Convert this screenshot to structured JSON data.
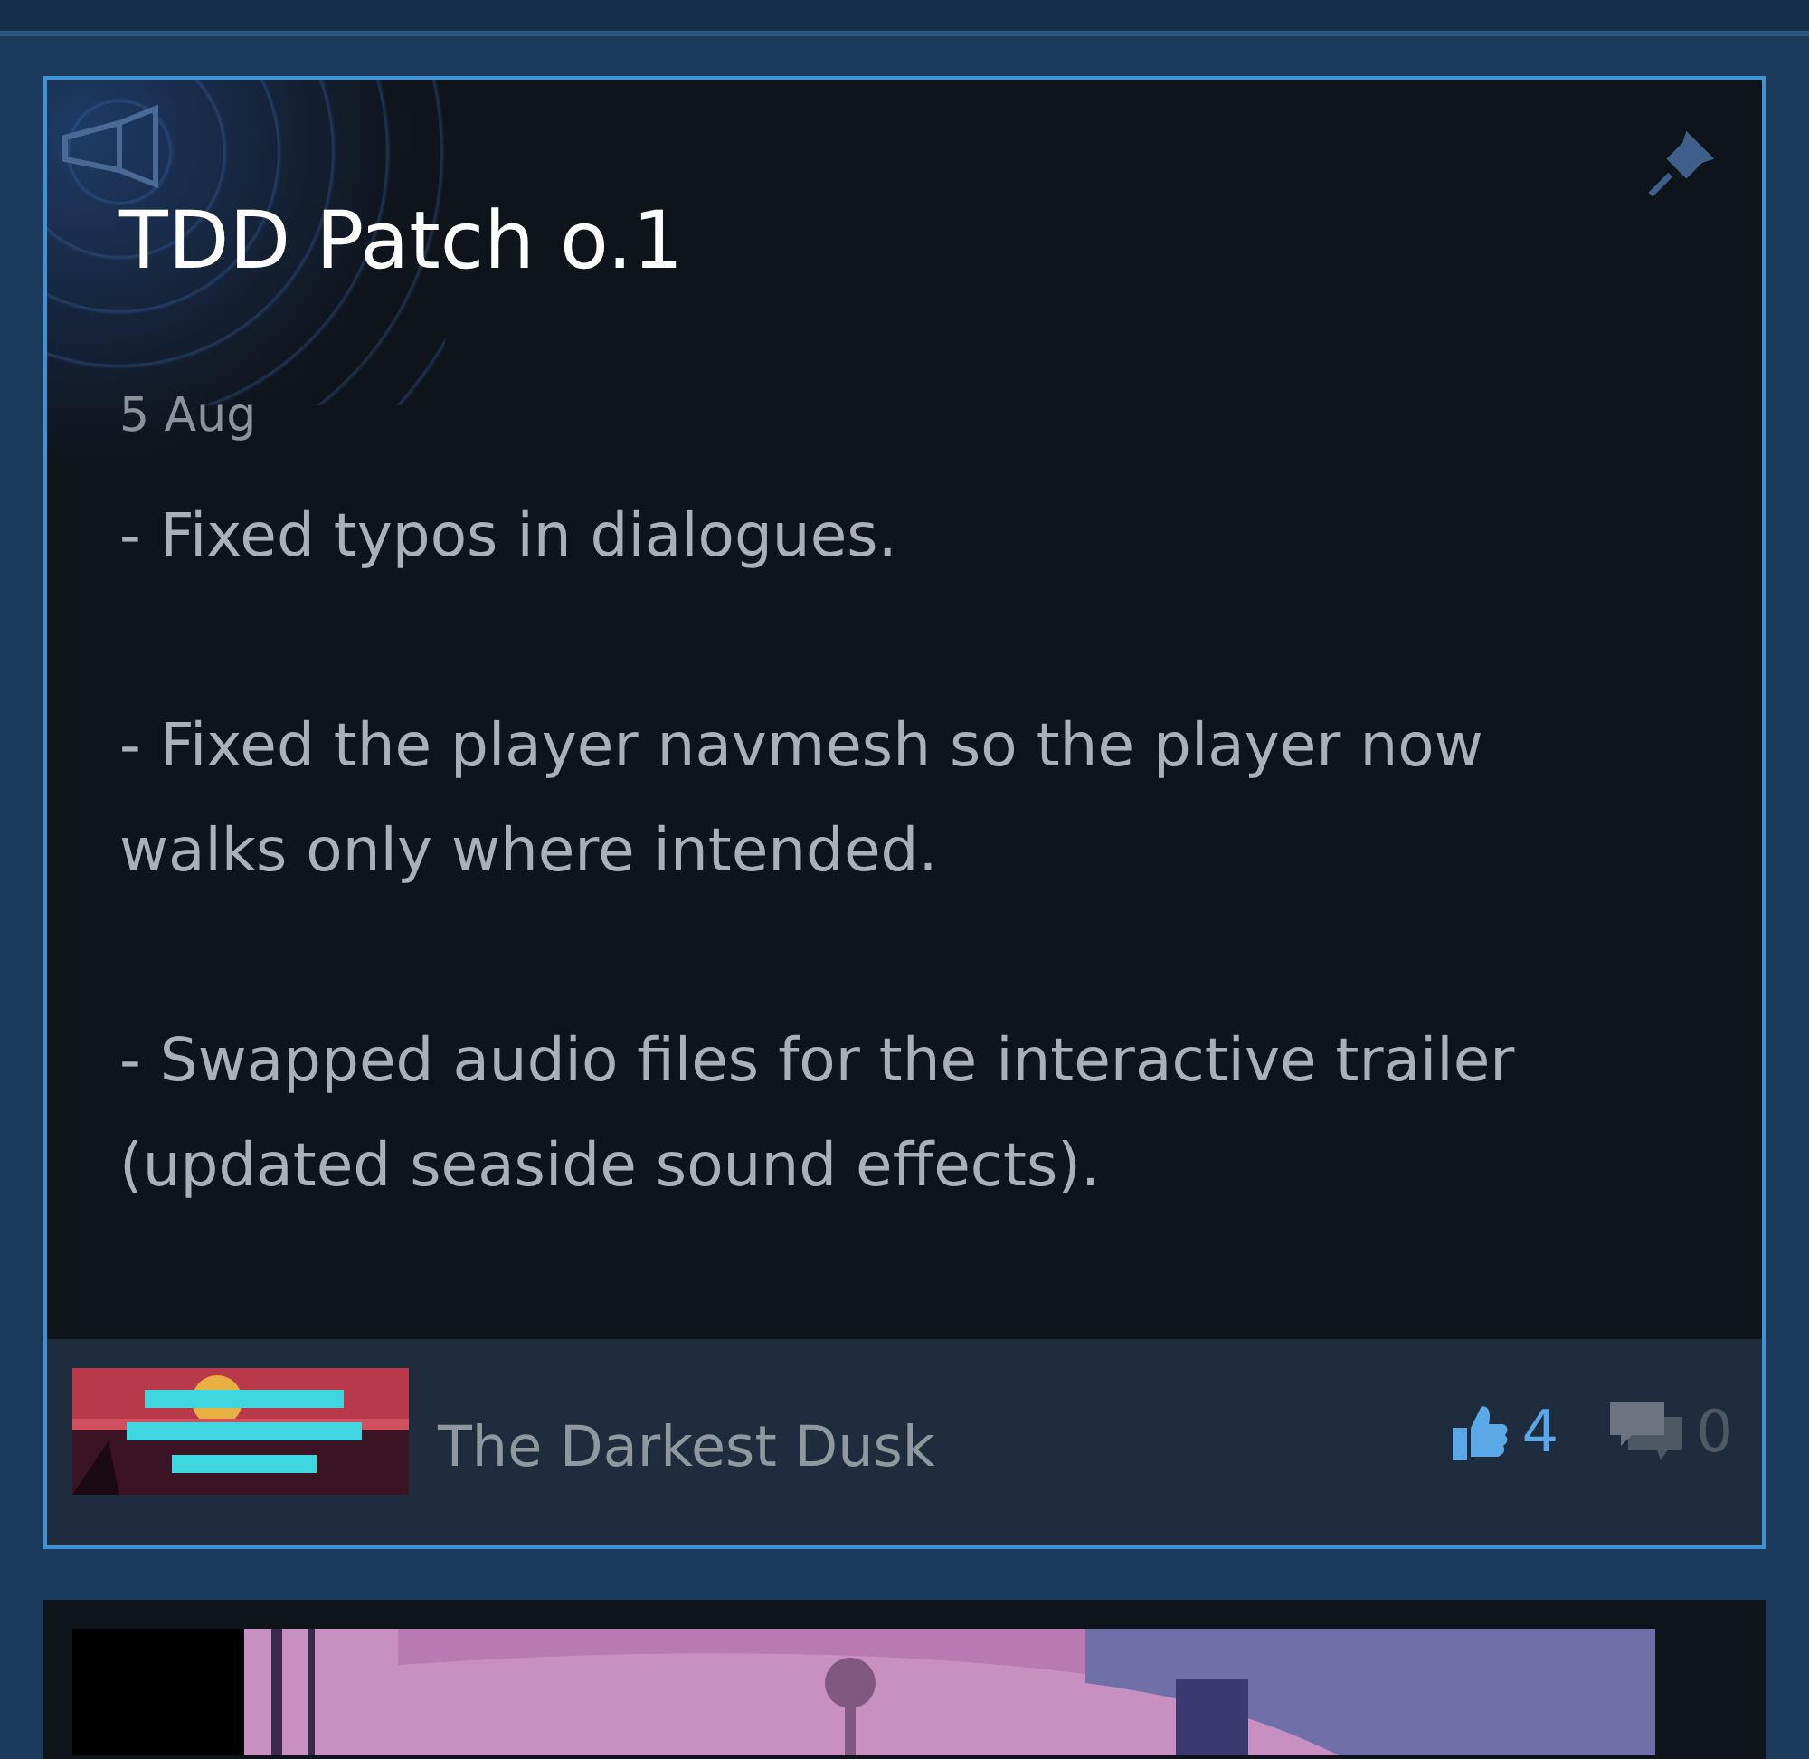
{
  "post": {
    "title": "TDD Patch o.1",
    "pinned": true,
    "date": "5 Aug",
    "paragraphs": [
      [
        "- Fixed typos in dialogues."
      ],
      [
        "- Fixed the player navmesh so the player now",
        "walks only where intended."
      ],
      [
        "- Swapped audio files for the interactive trailer",
        "(updated seaside sound effects)."
      ]
    ],
    "game": {
      "name": "The Darkest Dusk"
    },
    "votes": {
      "count": "4",
      "voted_up": true
    },
    "comments": {
      "count": "0"
    }
  }
}
